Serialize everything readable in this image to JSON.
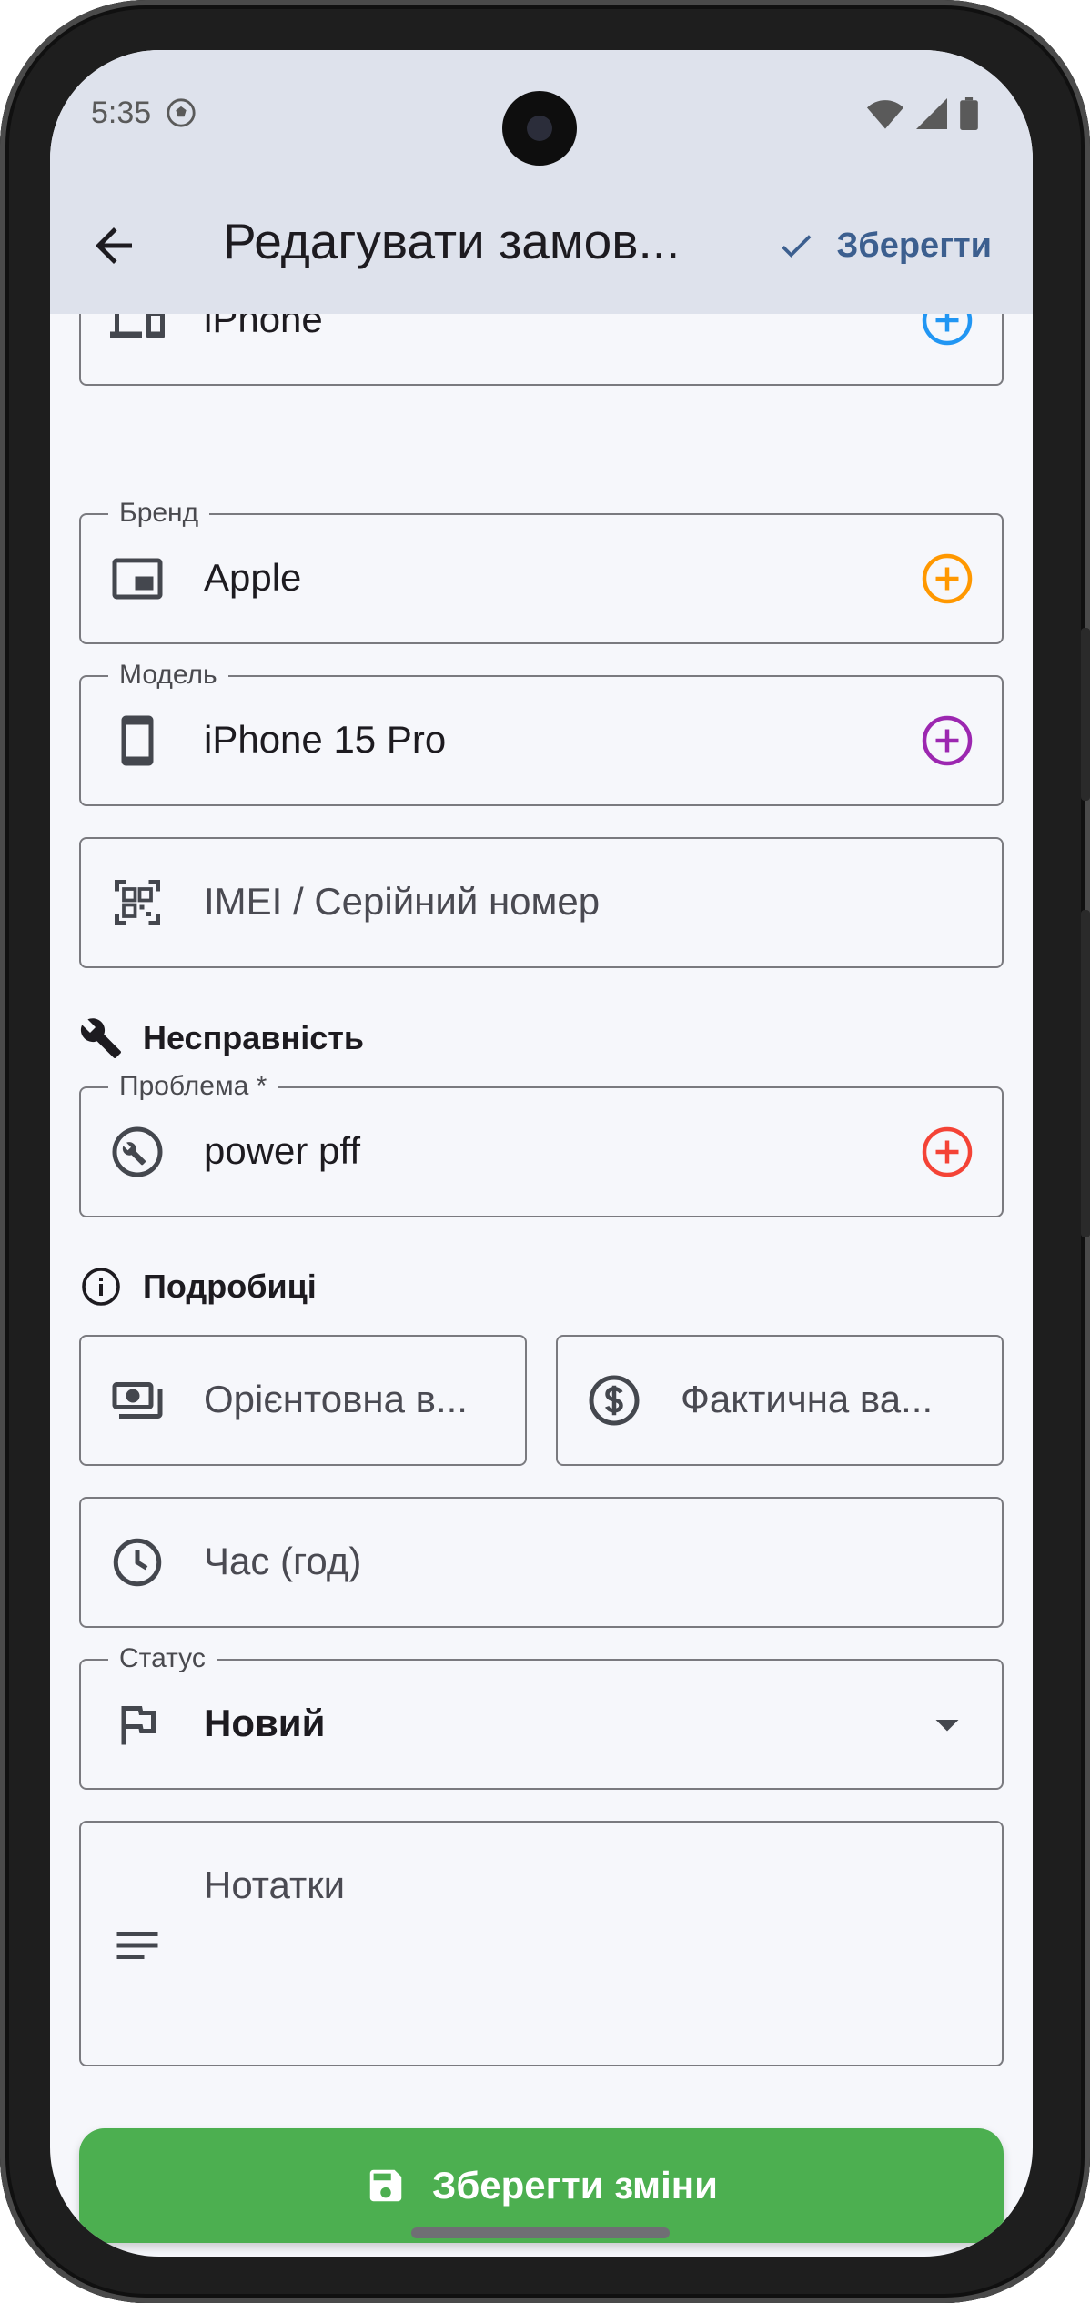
{
  "status_bar": {
    "time": "5:35"
  },
  "app_bar": {
    "title": "Редагувати замов...",
    "save_label": "Зберегти"
  },
  "device": {
    "type": {
      "value": "iPhone",
      "icon": "devices-icon",
      "add_color": "#2196f3"
    },
    "brand": {
      "label": "Бренд",
      "value": "Apple",
      "icon": "picture-in-picture-icon",
      "add_color": "#ff9800"
    },
    "model": {
      "label": "Модель",
      "value": "iPhone 15 Pro",
      "icon": "smartphone-icon",
      "add_color": "#9c27b0"
    },
    "imei": {
      "placeholder": "IMEI / Серійний номер",
      "icon": "qr-code-scanner-icon"
    }
  },
  "fault": {
    "heading": "Несправність",
    "problem": {
      "label": "Проблема *",
      "value": "power pff",
      "icon": "build-circle-icon",
      "add_color": "#f44336"
    }
  },
  "details": {
    "heading": "Подробиці",
    "estimated_cost": {
      "placeholder": "Орієнтовна в...",
      "icon": "payments-icon"
    },
    "actual_cost": {
      "placeholder": "Фактична ва...",
      "icon": "dollar-circle-icon"
    },
    "time_hours": {
      "placeholder": "Час (год)",
      "icon": "clock-icon"
    },
    "status": {
      "label": "Статус",
      "value": "Новий",
      "icon": "flag-icon"
    },
    "notes": {
      "placeholder": "Нотатки",
      "icon": "notes-icon"
    }
  },
  "primary_button": {
    "label": "Зберегти зміни",
    "color": "#4caf50"
  }
}
